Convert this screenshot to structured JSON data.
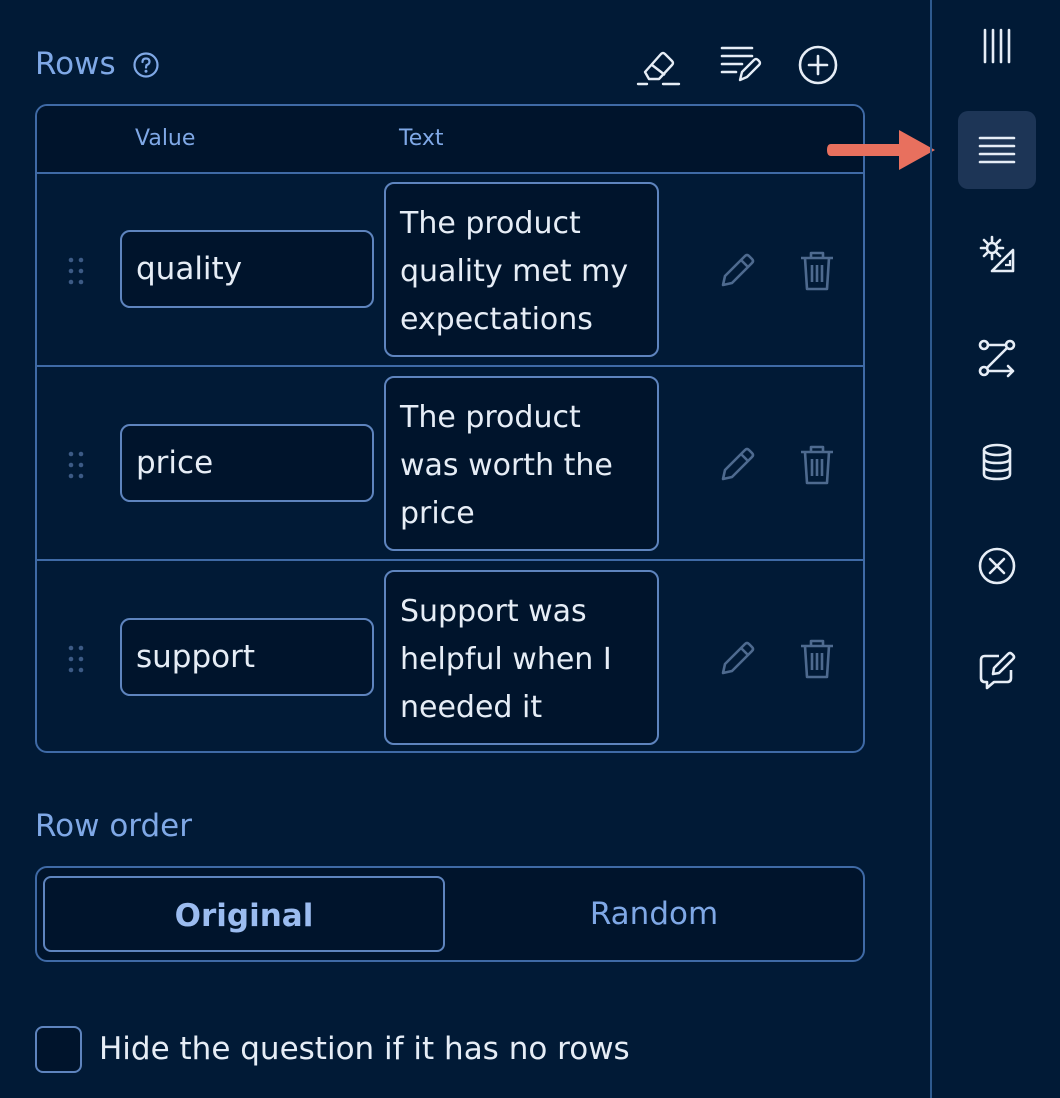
{
  "rows_section": {
    "title": "Rows",
    "columns": {
      "value": "Value",
      "text": "Text"
    },
    "items": [
      {
        "value": "quality",
        "text": "The product quality met my expectations"
      },
      {
        "value": "price",
        "text": "The product was worth the price"
      },
      {
        "value": "support",
        "text": "Support was helpful when I needed it"
      }
    ]
  },
  "row_order": {
    "title": "Row order",
    "options": [
      "Original",
      "Random"
    ],
    "selected": "Original"
  },
  "hide_if_empty": {
    "label": "Hide the question if it has no rows",
    "checked": false
  },
  "sidebar": {
    "items": [
      "columns-icon",
      "rows-icon",
      "settings-design-icon",
      "logic-icon",
      "data-icon",
      "validation-icon",
      "edit-feedback-icon"
    ],
    "active": "rows-icon"
  },
  "colors": {
    "background": "#011a36",
    "accent": "#7fa8e6",
    "border": "#3f6aa6",
    "arrow": "#e8705e"
  }
}
